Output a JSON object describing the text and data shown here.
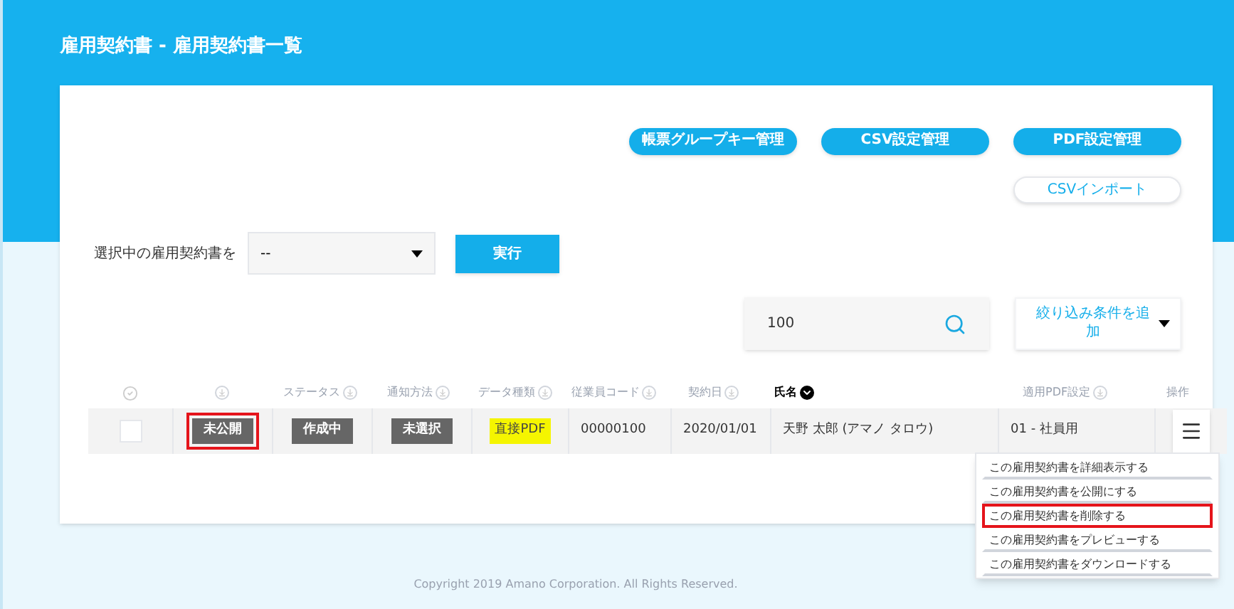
{
  "title": "雇用契約書 - 雇用契約書一覧",
  "top_buttons": [
    {
      "label": "帳票グループキー管理",
      "kind": "primary"
    },
    {
      "label": "CSV設定管理",
      "kind": "primary"
    },
    {
      "label": "PDF設定管理",
      "kind": "primary"
    },
    {
      "label": "CSVインポート",
      "kind": "outline"
    }
  ],
  "bulk_action": {
    "label": "選択中の雇用契約書を",
    "select_value": "--",
    "button": "実行"
  },
  "search": {
    "value": "100"
  },
  "filter_button": "絞り込み条件を追加",
  "table": {
    "columns": [
      {
        "kind": "checkbox"
      },
      {
        "kind": "sort",
        "sorted": false
      },
      {
        "kind": "sortable",
        "label": "ステータス",
        "sorted": false
      },
      {
        "kind": "sortable",
        "label": "通知方法",
        "sorted": false
      },
      {
        "kind": "sortable",
        "label": "データ種類",
        "sorted": false
      },
      {
        "kind": "sortable",
        "label": "従業員コード",
        "sorted": false
      },
      {
        "kind": "sortable",
        "label": "契約日",
        "sorted": false
      },
      {
        "kind": "sortable",
        "label": "氏名",
        "sorted": true
      },
      {
        "kind": "sortable",
        "label": "適用PDF設定",
        "sorted": false
      },
      {
        "kind": "plain",
        "label": "操作"
      }
    ],
    "rows": [
      {
        "cells": [
          {
            "kind": "checkbox",
            "checked": false
          },
          {
            "kind": "badge",
            "text": "未公開",
            "highlighted": true
          },
          {
            "kind": "badge",
            "text": "作成中",
            "highlighted": false
          },
          {
            "kind": "badge",
            "text": "未選択",
            "highlighted": false
          },
          {
            "kind": "tag",
            "text": "直接PDF"
          },
          {
            "kind": "text",
            "text": "00000100"
          },
          {
            "kind": "text",
            "text": "2020/01/01"
          },
          {
            "kind": "text",
            "text": "天野 太郎 (アマノ タロウ)"
          },
          {
            "kind": "text",
            "text": "01 - 社員用"
          },
          {
            "kind": "menu",
            "open": true
          }
        ]
      }
    ]
  },
  "action_menu": [
    {
      "label": "この雇用契約書を詳細表示する",
      "highlighted": false
    },
    {
      "label": "この雇用契約書を公開にする",
      "highlighted": false
    },
    {
      "label": "この雇用契約書を削除する",
      "highlighted": true
    },
    {
      "label": "この雇用契約書をプレビューする",
      "highlighted": false
    },
    {
      "label": "この雇用契約書をダウンロードする",
      "highlighted": false
    }
  ],
  "footer": "Copyright 2019 Amano Corporation. All Rights Reserved."
}
